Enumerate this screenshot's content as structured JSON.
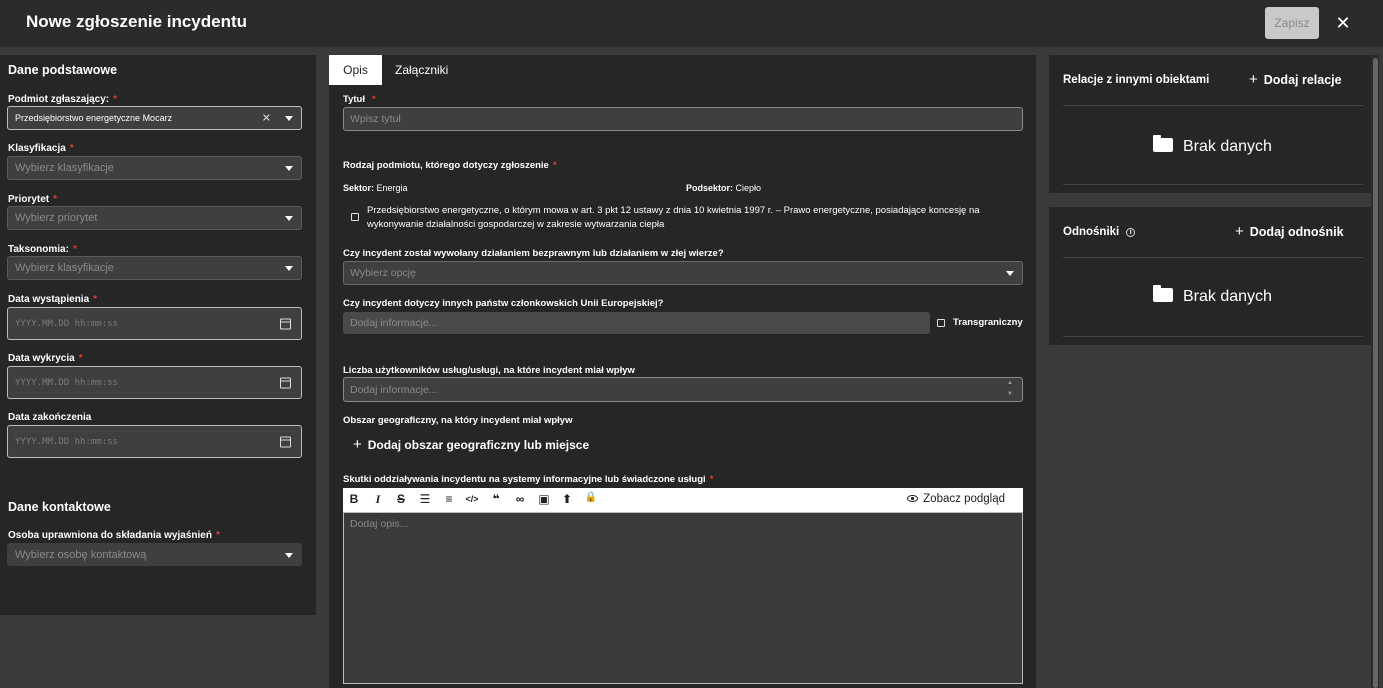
{
  "header": {
    "title": "Nowe zgłoszenie incydentu",
    "save_label": "Zapisz",
    "close_icon": "✕"
  },
  "left": {
    "basic_title": "Dane podstawowe",
    "reporter_label": "Podmiot zgłaszający:",
    "reporter_value": "Przedsiębiorstwo energetyczne Mocarz",
    "classification_label": "Klasyfikacja",
    "classification_placeholder": "Wybierz klasyfikacje",
    "priority_label": "Priorytet",
    "priority_placeholder": "Wybierz priorytet",
    "taxonomy_label": "Taksonomia:",
    "taxonomy_placeholder": "Wybierz klasyfikacje",
    "occurred_label": "Data wystąpienia",
    "detected_label": "Data wykrycia",
    "ended_label": "Data zakończenia",
    "date_placeholder": "YYYY.MM.DD hh:mm:ss",
    "contact_title": "Dane kontaktowe",
    "contact_label": "Osoba uprawniona do składania wyjaśnień",
    "contact_placeholder": "Wybierz osobę kontaktową",
    "required_mark": "*",
    "clear_icon": "✕"
  },
  "main": {
    "tabs": [
      {
        "label": "Opis"
      },
      {
        "label": "Załączniki"
      }
    ],
    "title_label": "Tytuł",
    "title_placeholder": "Wpisz tytuł",
    "entity_label": "Rodzaj podmiotu, którego dotyczy zgłoszenie",
    "sector_label": "Sektor:",
    "sector_value": "Energia",
    "subsector_label": "Podsektor:",
    "subsector_value": "Ciepło",
    "entity_checkbox_text": "Przedsiębiorstwo energetyczne, o którym mowa w art. 3 pkt 12 ustawy z dnia 10 kwietnia 1997 r. – Prawo energetyczne, posiadające koncesję na wykonywanie działalności gospodarczej w zakresie wytwarzania ciepła",
    "unlawful_label": "Czy incydent został wywołany działaniem bezprawnym lub działaniem w złej wierze?",
    "unlawful_placeholder": "Wybierz opcję",
    "eu_label": "Czy incydent dotyczy innych państw członkowskich Unii Europejskiej?",
    "info_placeholder": "Dodaj informacje...",
    "crossborder_label": "Transgraniczny",
    "users_label": "Liczba użytkowników usług/usługi, na które incydent miał wpływ",
    "geo_label": "Obszar geograficzny, na który incydent miał wpływ",
    "geo_add": "Dodaj obszar geograficzny lub miejsce",
    "impact_label": "Skutki oddziaływania incydentu na systemy informacyjne lub świadczone usługi",
    "preview_label": "Zobacz podgląd",
    "description_placeholder": "Dodaj opis...",
    "plus_icon": "+",
    "spinner_up": "▲",
    "spinner_down": "▼"
  },
  "toolbar_icons": [
    {
      "name": "bold-icon",
      "glyph": "B"
    },
    {
      "name": "italic-icon",
      "glyph": "I"
    },
    {
      "name": "strikethrough-icon",
      "glyph": "S"
    },
    {
      "name": "bullet-list-icon",
      "glyph": "☰"
    },
    {
      "name": "numbered-list-icon",
      "glyph": "≡"
    },
    {
      "name": "code-icon",
      "glyph": "</>"
    },
    {
      "name": "quote-icon",
      "glyph": "❝"
    },
    {
      "name": "link-icon",
      "glyph": "∞"
    },
    {
      "name": "image-icon",
      "glyph": "▣"
    },
    {
      "name": "file-upload-icon",
      "glyph": "⬆"
    },
    {
      "name": "lock-icon",
      "glyph": "🔒"
    }
  ],
  "right": {
    "relations_title": "Relacje z innymi obiektami",
    "relations_add": "Dodaj relacje",
    "links_title": "Odnośniki",
    "links_add": "Dodaj odnośnik",
    "no_data": "Brak danych",
    "info_glyph": "i",
    "plus_icon": "+"
  }
}
